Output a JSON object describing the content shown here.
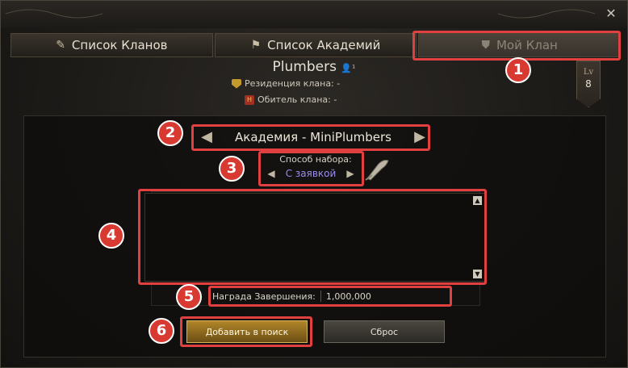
{
  "window": {
    "close_label": "✕"
  },
  "tabs": [
    {
      "label": "Список Кланов",
      "icon": "scroll-icon"
    },
    {
      "label": "Список Академий",
      "icon": "academy-icon"
    },
    {
      "label": "Мой Клан",
      "icon": "shield-icon",
      "active": true
    }
  ],
  "clan": {
    "name": "Plumbers",
    "member_marker": "¹",
    "residence_label": "Резиденция клана: -",
    "hall_label": "Обитель клана: -"
  },
  "level": {
    "label": "Lv",
    "value": "8"
  },
  "academy_selector": {
    "value": "Академия - MiniPlumbers"
  },
  "recruit": {
    "label": "Способ набора:",
    "value": "С заявкой"
  },
  "reward": {
    "label": "Награда Завершения:",
    "value": "1,000,000"
  },
  "buttons": {
    "add_label": "Добавить в поиск",
    "reset_label": "Сброс"
  },
  "callouts": [
    "1",
    "2",
    "3",
    "4",
    "5",
    "6"
  ],
  "colors": {
    "highlight": "#e04040",
    "accent_gold": "#b08629",
    "recruit_text": "#9a8cf0"
  }
}
